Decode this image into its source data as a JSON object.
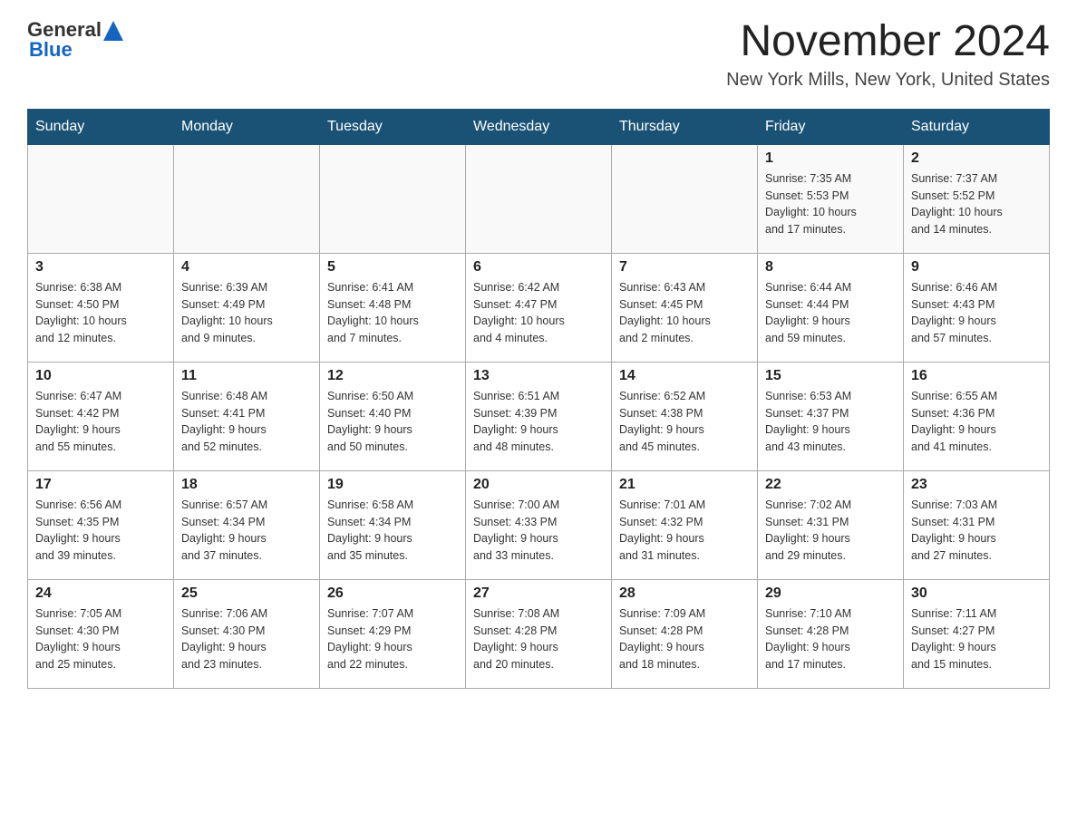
{
  "header": {
    "logo_general": "General",
    "logo_blue": "Blue",
    "month_title": "November 2024",
    "location": "New York Mills, New York, United States"
  },
  "days_of_week": [
    "Sunday",
    "Monday",
    "Tuesday",
    "Wednesday",
    "Thursday",
    "Friday",
    "Saturday"
  ],
  "weeks": [
    [
      {
        "day": "",
        "info": ""
      },
      {
        "day": "",
        "info": ""
      },
      {
        "day": "",
        "info": ""
      },
      {
        "day": "",
        "info": ""
      },
      {
        "day": "",
        "info": ""
      },
      {
        "day": "1",
        "info": "Sunrise: 7:35 AM\nSunset: 5:53 PM\nDaylight: 10 hours\nand 17 minutes."
      },
      {
        "day": "2",
        "info": "Sunrise: 7:37 AM\nSunset: 5:52 PM\nDaylight: 10 hours\nand 14 minutes."
      }
    ],
    [
      {
        "day": "3",
        "info": "Sunrise: 6:38 AM\nSunset: 4:50 PM\nDaylight: 10 hours\nand 12 minutes."
      },
      {
        "day": "4",
        "info": "Sunrise: 6:39 AM\nSunset: 4:49 PM\nDaylight: 10 hours\nand 9 minutes."
      },
      {
        "day": "5",
        "info": "Sunrise: 6:41 AM\nSunset: 4:48 PM\nDaylight: 10 hours\nand 7 minutes."
      },
      {
        "day": "6",
        "info": "Sunrise: 6:42 AM\nSunset: 4:47 PM\nDaylight: 10 hours\nand 4 minutes."
      },
      {
        "day": "7",
        "info": "Sunrise: 6:43 AM\nSunset: 4:45 PM\nDaylight: 10 hours\nand 2 minutes."
      },
      {
        "day": "8",
        "info": "Sunrise: 6:44 AM\nSunset: 4:44 PM\nDaylight: 9 hours\nand 59 minutes."
      },
      {
        "day": "9",
        "info": "Sunrise: 6:46 AM\nSunset: 4:43 PM\nDaylight: 9 hours\nand 57 minutes."
      }
    ],
    [
      {
        "day": "10",
        "info": "Sunrise: 6:47 AM\nSunset: 4:42 PM\nDaylight: 9 hours\nand 55 minutes."
      },
      {
        "day": "11",
        "info": "Sunrise: 6:48 AM\nSunset: 4:41 PM\nDaylight: 9 hours\nand 52 minutes."
      },
      {
        "day": "12",
        "info": "Sunrise: 6:50 AM\nSunset: 4:40 PM\nDaylight: 9 hours\nand 50 minutes."
      },
      {
        "day": "13",
        "info": "Sunrise: 6:51 AM\nSunset: 4:39 PM\nDaylight: 9 hours\nand 48 minutes."
      },
      {
        "day": "14",
        "info": "Sunrise: 6:52 AM\nSunset: 4:38 PM\nDaylight: 9 hours\nand 45 minutes."
      },
      {
        "day": "15",
        "info": "Sunrise: 6:53 AM\nSunset: 4:37 PM\nDaylight: 9 hours\nand 43 minutes."
      },
      {
        "day": "16",
        "info": "Sunrise: 6:55 AM\nSunset: 4:36 PM\nDaylight: 9 hours\nand 41 minutes."
      }
    ],
    [
      {
        "day": "17",
        "info": "Sunrise: 6:56 AM\nSunset: 4:35 PM\nDaylight: 9 hours\nand 39 minutes."
      },
      {
        "day": "18",
        "info": "Sunrise: 6:57 AM\nSunset: 4:34 PM\nDaylight: 9 hours\nand 37 minutes."
      },
      {
        "day": "19",
        "info": "Sunrise: 6:58 AM\nSunset: 4:34 PM\nDaylight: 9 hours\nand 35 minutes."
      },
      {
        "day": "20",
        "info": "Sunrise: 7:00 AM\nSunset: 4:33 PM\nDaylight: 9 hours\nand 33 minutes."
      },
      {
        "day": "21",
        "info": "Sunrise: 7:01 AM\nSunset: 4:32 PM\nDaylight: 9 hours\nand 31 minutes."
      },
      {
        "day": "22",
        "info": "Sunrise: 7:02 AM\nSunset: 4:31 PM\nDaylight: 9 hours\nand 29 minutes."
      },
      {
        "day": "23",
        "info": "Sunrise: 7:03 AM\nSunset: 4:31 PM\nDaylight: 9 hours\nand 27 minutes."
      }
    ],
    [
      {
        "day": "24",
        "info": "Sunrise: 7:05 AM\nSunset: 4:30 PM\nDaylight: 9 hours\nand 25 minutes."
      },
      {
        "day": "25",
        "info": "Sunrise: 7:06 AM\nSunset: 4:30 PM\nDaylight: 9 hours\nand 23 minutes."
      },
      {
        "day": "26",
        "info": "Sunrise: 7:07 AM\nSunset: 4:29 PM\nDaylight: 9 hours\nand 22 minutes."
      },
      {
        "day": "27",
        "info": "Sunrise: 7:08 AM\nSunset: 4:28 PM\nDaylight: 9 hours\nand 20 minutes."
      },
      {
        "day": "28",
        "info": "Sunrise: 7:09 AM\nSunset: 4:28 PM\nDaylight: 9 hours\nand 18 minutes."
      },
      {
        "day": "29",
        "info": "Sunrise: 7:10 AM\nSunset: 4:28 PM\nDaylight: 9 hours\nand 17 minutes."
      },
      {
        "day": "30",
        "info": "Sunrise: 7:11 AM\nSunset: 4:27 PM\nDaylight: 9 hours\nand 15 minutes."
      }
    ]
  ]
}
